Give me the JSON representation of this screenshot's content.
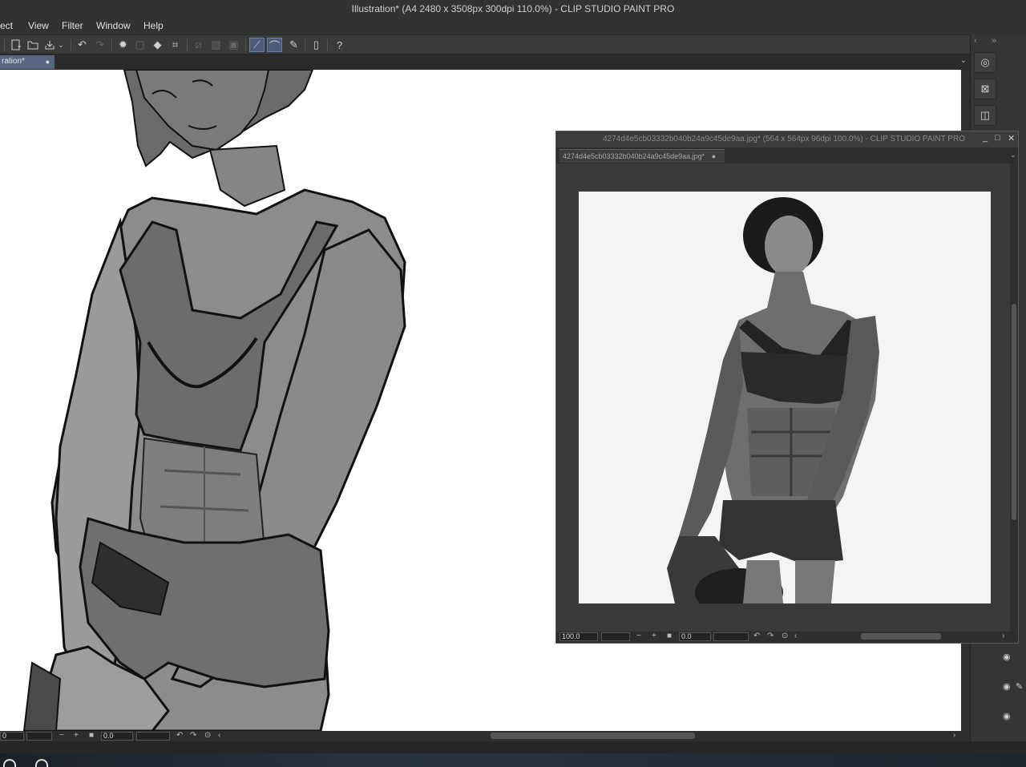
{
  "window": {
    "title": "Illustration* (A4 2480 x 3508px 300dpi 110.0%)  - CLIP STUDIO PAINT PRO"
  },
  "menu": [
    {
      "label": "ect"
    },
    {
      "label": "View"
    },
    {
      "label": "Filter"
    },
    {
      "label": "Window"
    },
    {
      "label": "Help"
    }
  ],
  "canvas_tab": {
    "label": "ration*",
    "dot": "●"
  },
  "nav": {
    "zoom": "0",
    "rotate": "0.0"
  },
  "reference": {
    "title": "4274d4e5cb03332b040b24a9c45de9aa.jpg* (564 x 564px 96dpi 100.0%)  - CLIP STUDIO PAINT PRO",
    "tab": "4274d4e5cb03332b040b24a9c45de9aa.jpg*",
    "tab_dot": "●",
    "zoom": "100.0",
    "rotate": "0.0"
  },
  "colors": {
    "accent": "#566582",
    "toolbar_active": "#4a5a78"
  },
  "icons": [
    "new-file-icon",
    "open-file-icon",
    "save-icon",
    "undo-icon",
    "redo-icon",
    "selection-icon",
    "fill-icon",
    "transform-icon",
    "ruler-icon",
    "snap-icon",
    "pen-icon",
    "help-icon",
    "eye-icon"
  ]
}
